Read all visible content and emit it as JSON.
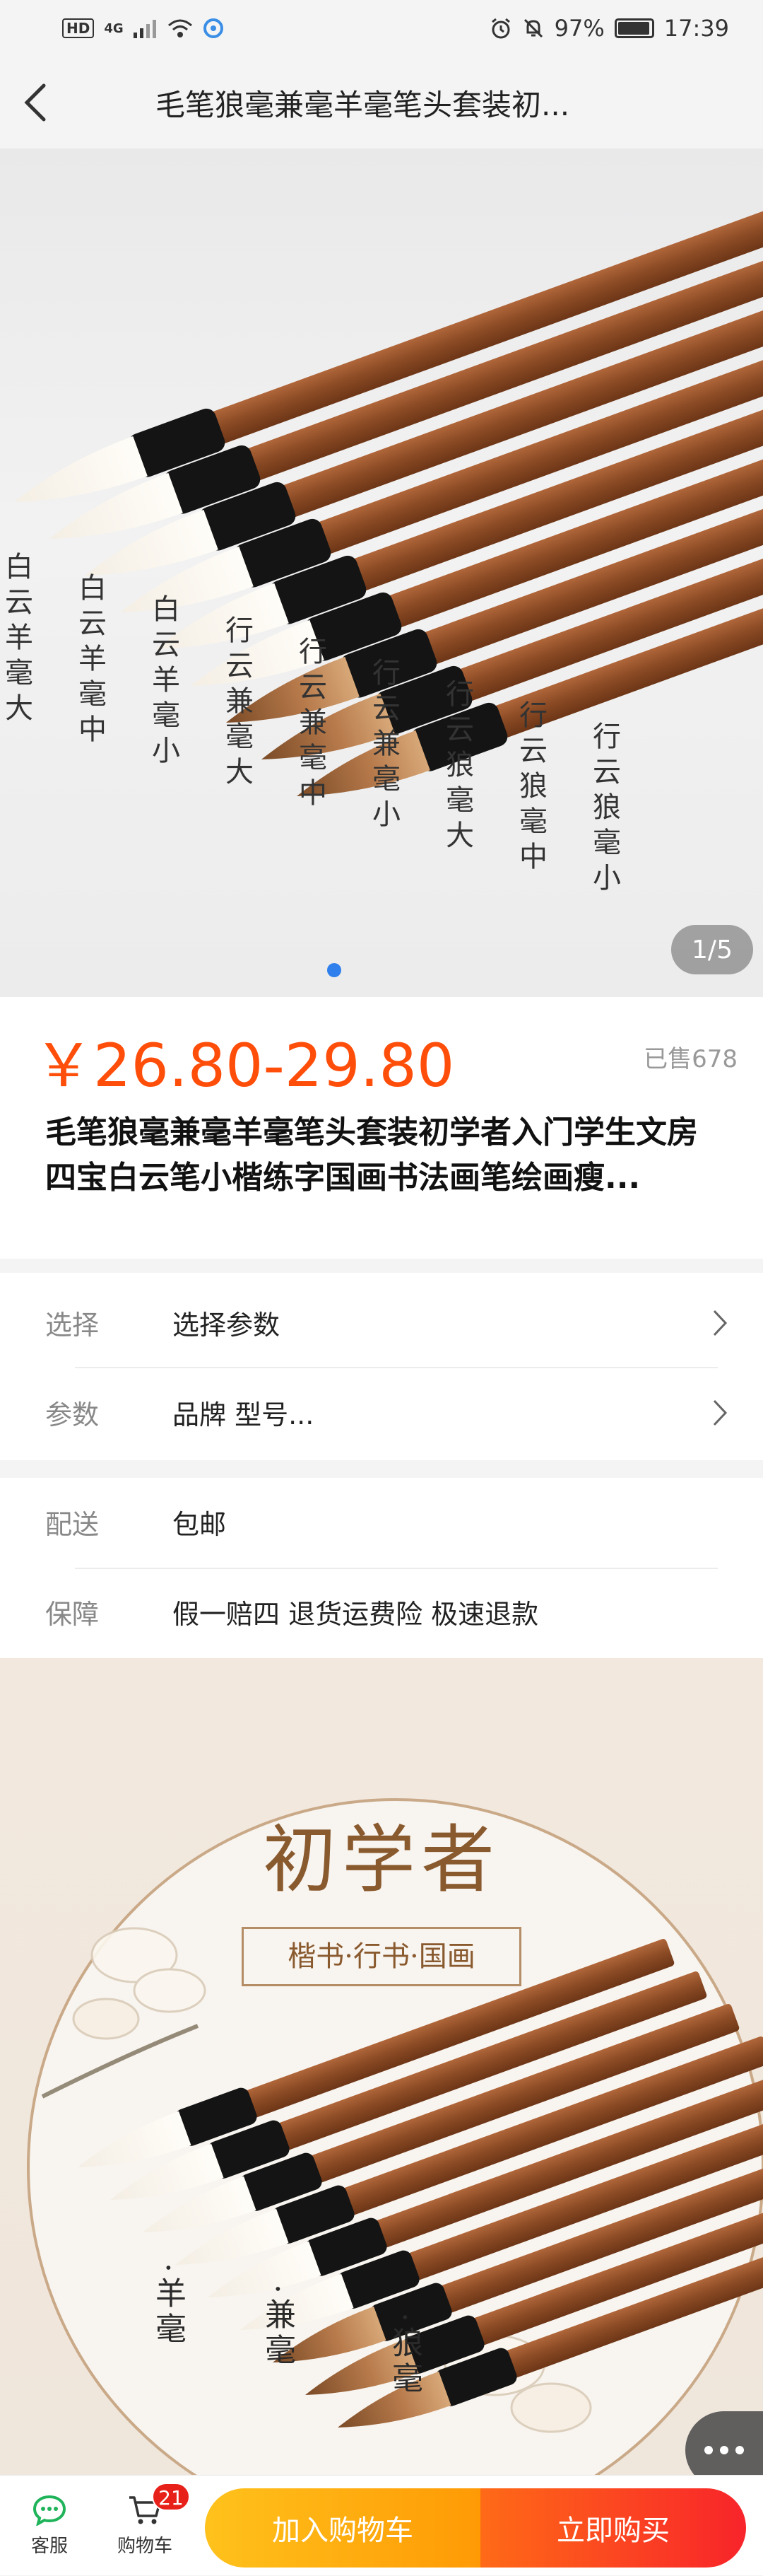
{
  "status_bar": {
    "hd": "HD",
    "network": "4G",
    "battery": "97%",
    "battery_level": 0.97,
    "time": "17:39"
  },
  "header": {
    "title": "毛笔狼毫兼毫羊毫笔头套装初..."
  },
  "gallery": {
    "labels": [
      "白云羊毫大",
      "白云羊毫中",
      "白云羊毫小",
      "行云兼毫大",
      "行云兼毫中",
      "行云兼毫小",
      "行云狼毫大",
      "行云狼毫中",
      "行云狼毫小"
    ],
    "page_indicator": "1/5",
    "current_page": 1,
    "total_pages": 5
  },
  "product": {
    "price": "￥26.80-29.80",
    "sold": "已售678",
    "title": "毛笔狼毫兼毫羊毫笔头套装初学者入门学生文房四宝白云笔小楷练字国画书法画笔绘画瘦..."
  },
  "options": [
    {
      "label": "选择",
      "value": "选择参数"
    },
    {
      "label": "参数",
      "value": "品牌 型号..."
    }
  ],
  "info": [
    {
      "label": "配送",
      "value": "包邮"
    },
    {
      "label": "保障",
      "value": "假一赔四 退货运费险 极速退款"
    }
  ],
  "detail_image": {
    "title": "初学者",
    "subtitle": "楷书·行书·国画",
    "types": [
      "·羊毫",
      "·兼毫",
      "·狼毫"
    ]
  },
  "bottom_bar": {
    "service_label": "客服",
    "cart_label": "购物车",
    "cart_count": "21",
    "add_to_cart": "加入购物车",
    "buy_now": "立即购买"
  },
  "colors": {
    "price": "#ff4d0a",
    "add_to_cart_start": "#ffc21c",
    "add_to_cart_end": "#ff9a05",
    "buy_now_start": "#ff6a17",
    "buy_now_end": "#f8242a",
    "indicator_dot": "#2f80ed",
    "service_icon": "#1fb35a"
  }
}
